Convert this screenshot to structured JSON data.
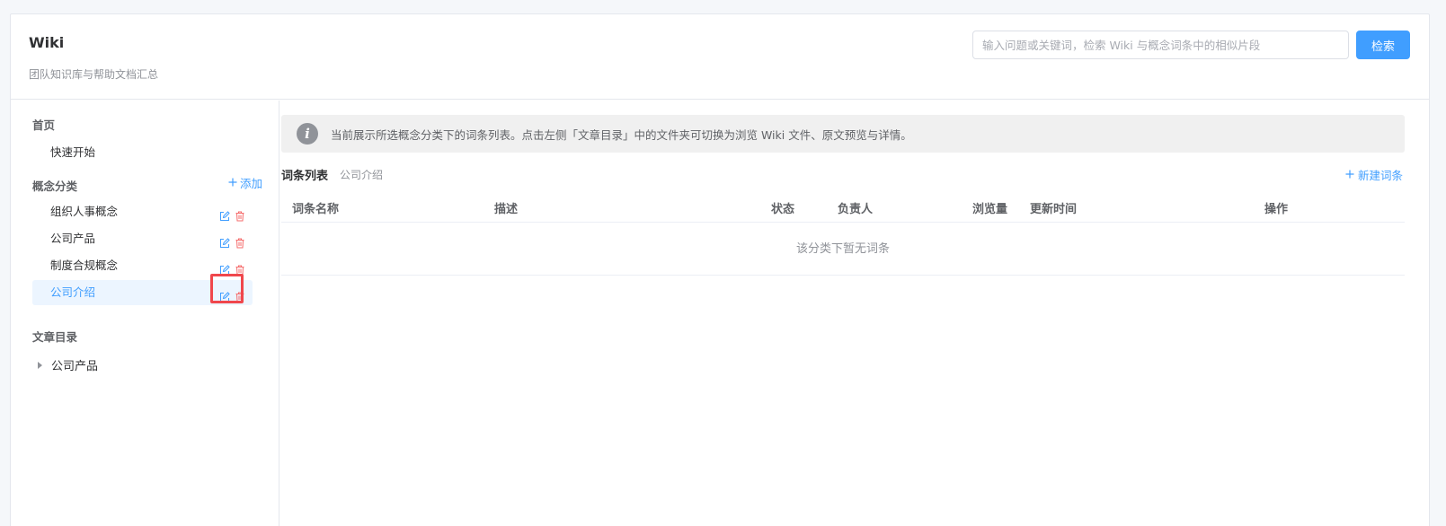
{
  "header": {
    "title": "Wiki",
    "subtitle": "团队知识库与帮助文档汇总",
    "search_placeholder": "输入问题或关键词，检索 Wiki 与概念词条中的相似片段",
    "search_button": "检索"
  },
  "sidebar": {
    "home_section": "首页",
    "quick_start": "快速开始",
    "concept_section": "概念分类",
    "add_label": "添加",
    "categories": [
      {
        "label": "组织人事概念"
      },
      {
        "label": "公司产品"
      },
      {
        "label": "制度合规概念"
      },
      {
        "label": "公司介绍"
      }
    ],
    "article_section": "文章目录",
    "tree_items": [
      {
        "label": "公司产品"
      }
    ]
  },
  "main": {
    "info_text": "当前展示所选概念分类下的词条列表。点击左侧「文章目录」中的文件夹可切换为浏览 Wiki 文件、原文预览与详情。",
    "list_title": "词条列表",
    "list_subtitle": "公司介绍",
    "new_entry": "新建词条",
    "columns": [
      "词条名称",
      "描述",
      "状态",
      "负责人",
      "浏览量",
      "更新时间",
      "操作"
    ],
    "empty_text": "该分类下暂无词条"
  },
  "colors": {
    "accent": "#409eff",
    "danger": "#f56c6c",
    "highlight": "#f0474c"
  }
}
